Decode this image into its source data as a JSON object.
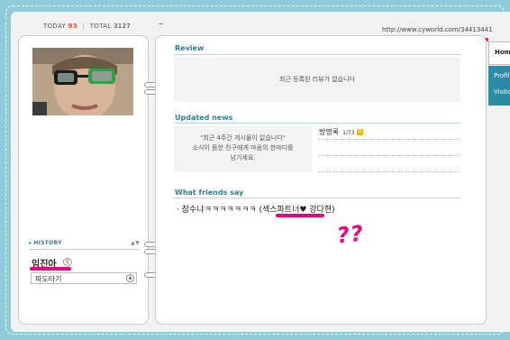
{
  "counter": {
    "today_label": "TODAY",
    "today_value": "93",
    "separator": "|",
    "total_label": "TOTAL",
    "total_value": "3127"
  },
  "header": {
    "dash": "–",
    "url": "http://www.cyworld.com/34413441"
  },
  "profile": {
    "photo_icon": "profile-photo",
    "history_label": "HISTORY",
    "owner_name": "임진아",
    "owner_badge": "♀",
    "select_value": "파도타기",
    "select_button": "▲"
  },
  "review": {
    "title": "Review",
    "empty_text": "최근 등록된 리뷰가 없습니다"
  },
  "news": {
    "title": "Updated news",
    "empty_line1": "\"최근 4주간 게시물이 없습니다\"",
    "empty_line2": "소식이 뜸한 친구에게 마음의 한마디를",
    "empty_line3": "남기세요.",
    "guestbook_label": "방명록",
    "guestbook_count": "1/73",
    "new_badge": "N"
  },
  "friends": {
    "title": "What friends say",
    "bullet": "·",
    "comment": "잠수냐ㅋㅋㅋㅋㅋㅋㅋ",
    "relation": "(섹스파트너♥ 강다현)"
  },
  "annotation": {
    "question_marks": "??"
  },
  "tabs": [
    {
      "label": "Home"
    },
    {
      "label": "Profile"
    },
    {
      "label": "Visitor"
    }
  ],
  "colors": {
    "background": "#8fcbd8",
    "accent": "#2b7f96",
    "tab": "#2b8ba5",
    "annotation": "#e6007e"
  }
}
